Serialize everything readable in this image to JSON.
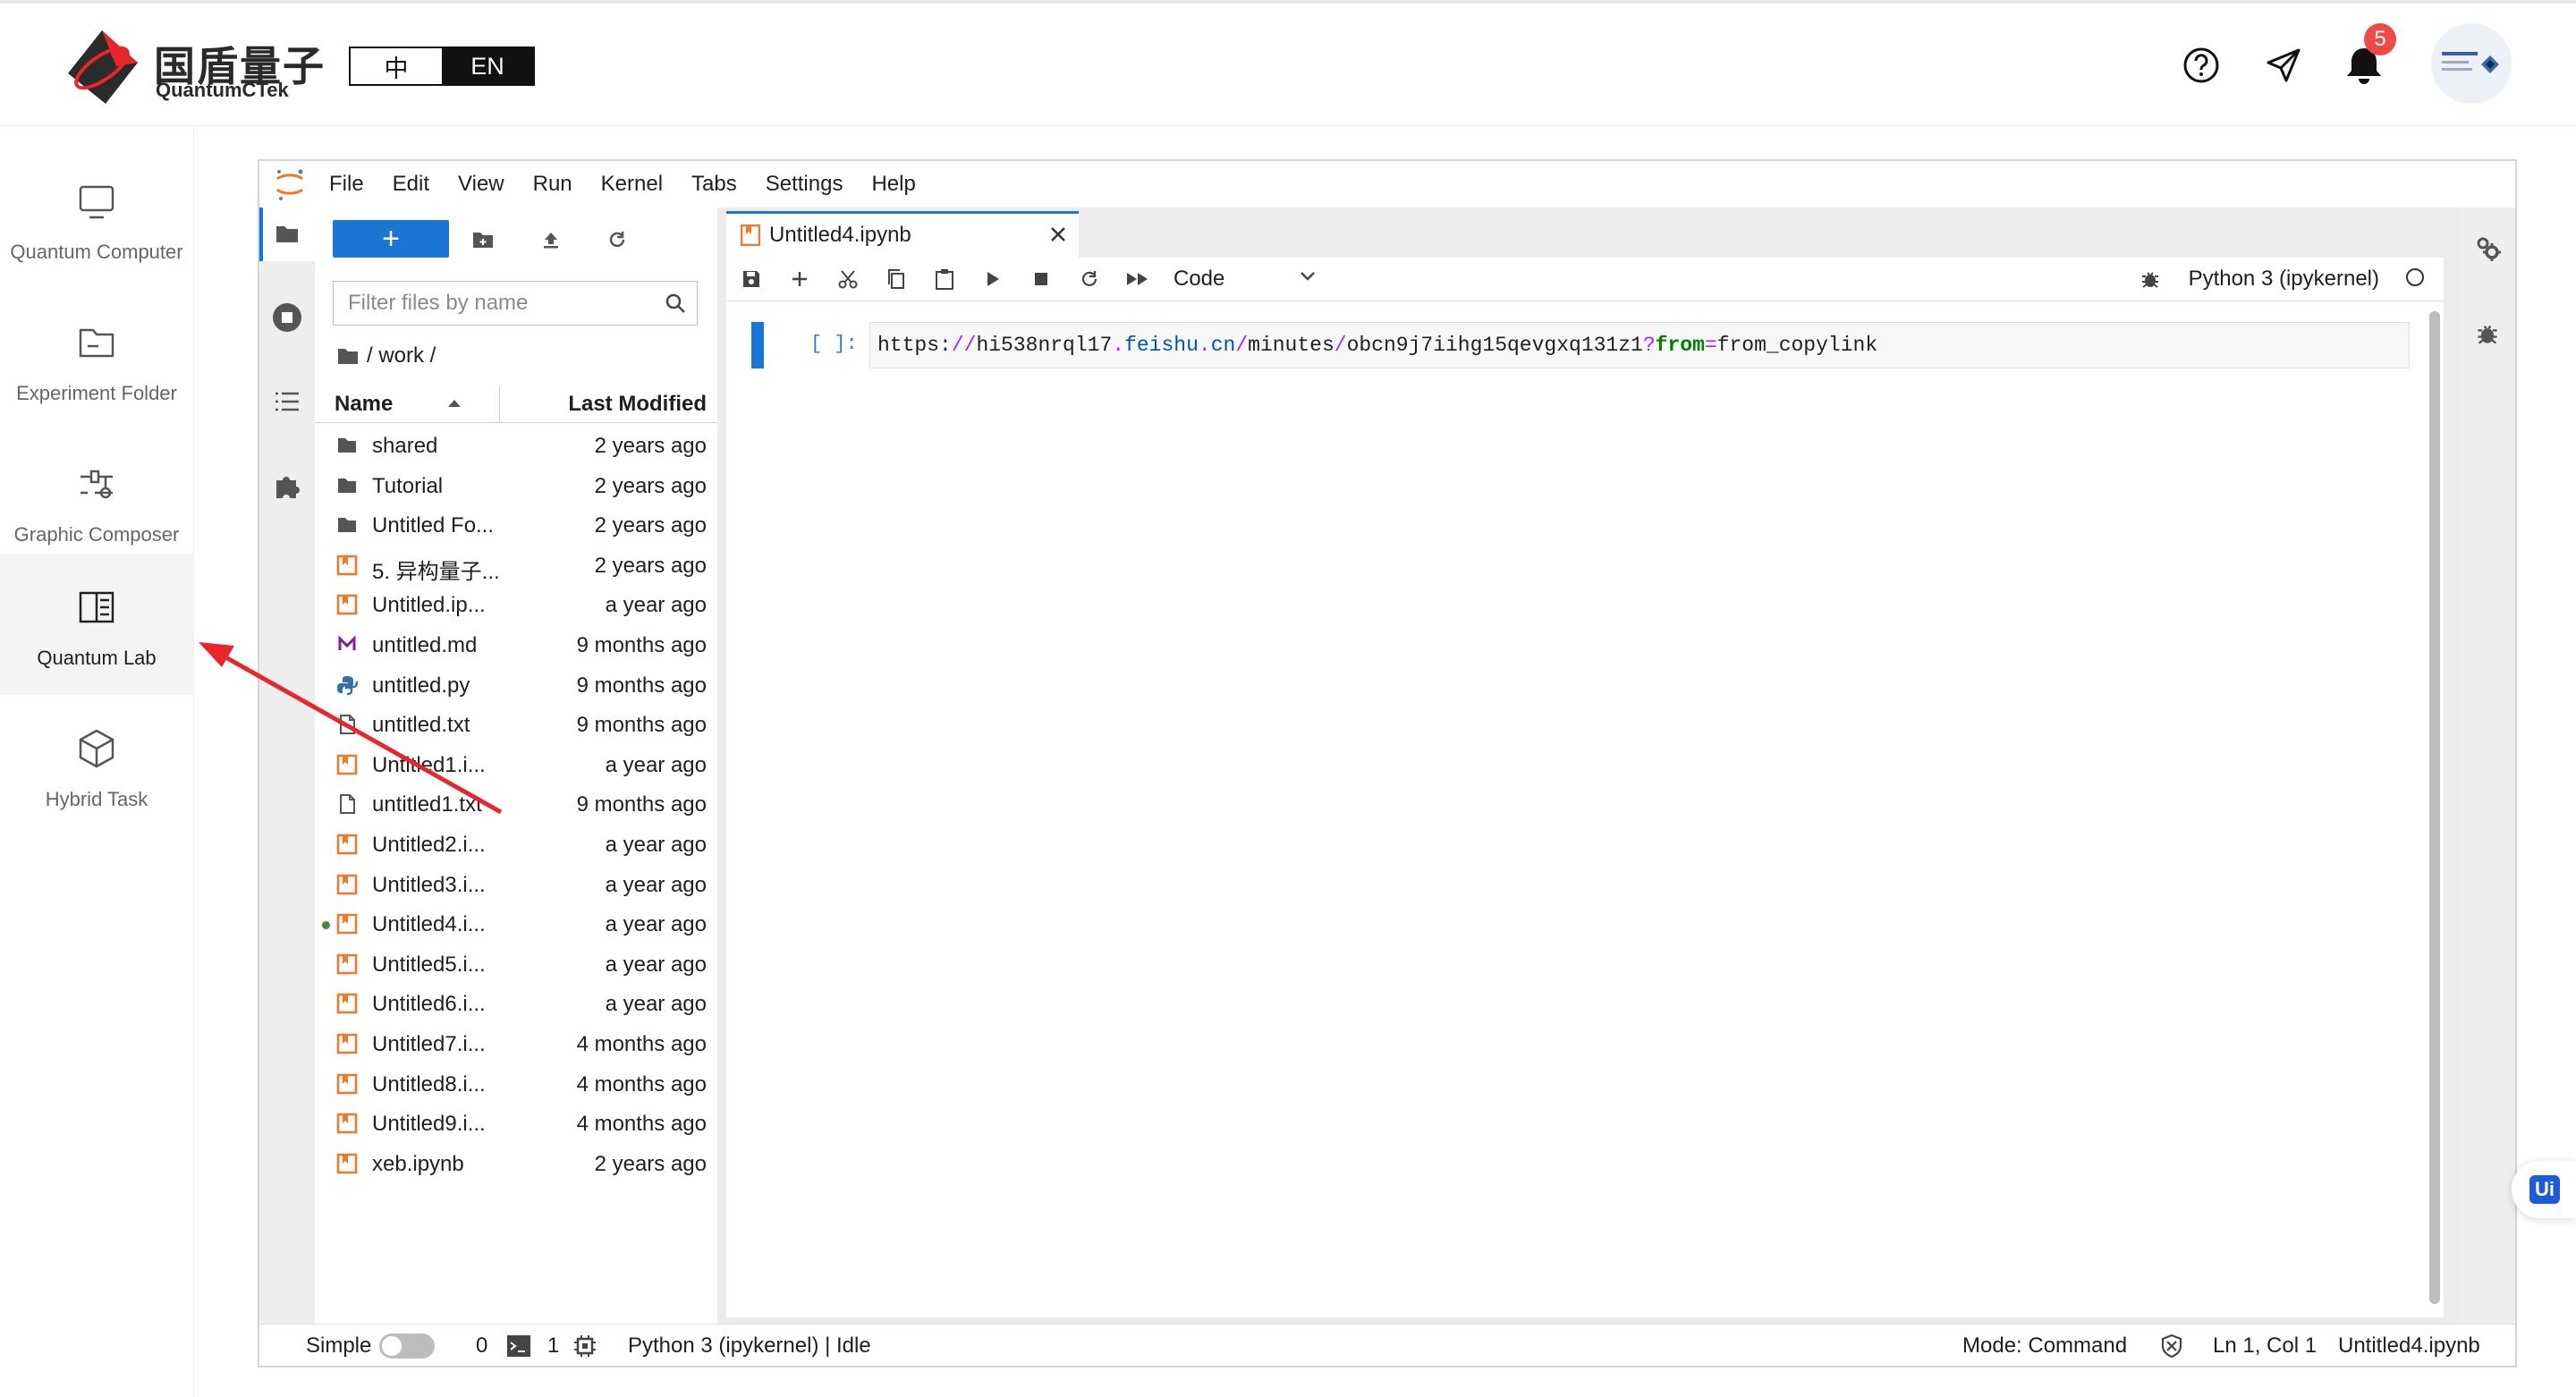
{
  "header": {
    "logo_cn": "国盾量子",
    "logo_en": "QuantumCTek",
    "lang_zh": "中",
    "lang_en": "EN",
    "notification_count": "5",
    "icons": [
      "help-icon",
      "send-icon",
      "bell-icon"
    ]
  },
  "leftnav": {
    "items": [
      {
        "label": "Quantum Computer",
        "icon": "monitor-icon"
      },
      {
        "label": "Experiment Folder",
        "icon": "folder-icon"
      },
      {
        "label": "Graphic Composer",
        "icon": "circuit-icon"
      },
      {
        "label": "Quantum Lab",
        "icon": "lab-panel-icon",
        "active": true
      },
      {
        "label": "Hybrid Task",
        "icon": "cube-icon"
      }
    ]
  },
  "jupyter": {
    "menu": [
      "File",
      "Edit",
      "View",
      "Run",
      "Kernel",
      "Tabs",
      "Settings",
      "Help"
    ],
    "filebrowser": {
      "new_label": "+",
      "filter_placeholder": "Filter files by name",
      "breadcrumb": "/ work /",
      "col_name": "Name",
      "col_modified": "Last Modified",
      "files": [
        {
          "name": "shared",
          "modified": "2 years ago",
          "type": "folder"
        },
        {
          "name": "Tutorial",
          "modified": "2 years ago",
          "type": "folder"
        },
        {
          "name": "Untitled Fo...",
          "modified": "2 years ago",
          "type": "folder"
        },
        {
          "name": "5. 异构量子...",
          "modified": "2 years ago",
          "type": "notebook"
        },
        {
          "name": "Untitled.ip...",
          "modified": "a year ago",
          "type": "notebook"
        },
        {
          "name": "untitled.md",
          "modified": "9 months ago",
          "type": "markdown"
        },
        {
          "name": "untitled.py",
          "modified": "9 months ago",
          "type": "python"
        },
        {
          "name": "untitled.txt",
          "modified": "9 months ago",
          "type": "text"
        },
        {
          "name": "Untitled1.i...",
          "modified": "a year ago",
          "type": "notebook"
        },
        {
          "name": "untitled1.txt",
          "modified": "9 months ago",
          "type": "text"
        },
        {
          "name": "Untitled2.i...",
          "modified": "a year ago",
          "type": "notebook"
        },
        {
          "name": "Untitled3.i...",
          "modified": "a year ago",
          "type": "notebook"
        },
        {
          "name": "Untitled4.i...",
          "modified": "a year ago",
          "type": "notebook",
          "running": true
        },
        {
          "name": "Untitled5.i...",
          "modified": "a year ago",
          "type": "notebook"
        },
        {
          "name": "Untitled6.i...",
          "modified": "a year ago",
          "type": "notebook"
        },
        {
          "name": "Untitled7.i...",
          "modified": "4 months ago",
          "type": "notebook"
        },
        {
          "name": "Untitled8.i...",
          "modified": "4 months ago",
          "type": "notebook"
        },
        {
          "name": "Untitled9.i...",
          "modified": "4 months ago",
          "type": "notebook"
        },
        {
          "name": "xeb.ipynb",
          "modified": "2 years ago",
          "type": "notebook"
        }
      ]
    },
    "notebook": {
      "tab_title": "Untitled4.ipynb",
      "cell_type": "Code",
      "kernel": "Python 3 (ipykernel)",
      "cell_prompt": "[ ]:",
      "cell_tokens": [
        {
          "t": "https:",
          "c": ""
        },
        {
          "t": "//",
          "c": "m"
        },
        {
          "t": "hi538nrql17",
          "c": ""
        },
        {
          "t": ".",
          "c": "m"
        },
        {
          "t": "feishu",
          "c": "b"
        },
        {
          "t": ".",
          "c": "m"
        },
        {
          "t": "cn",
          "c": "b"
        },
        {
          "t": "/",
          "c": "m"
        },
        {
          "t": "minutes",
          "c": ""
        },
        {
          "t": "/",
          "c": "m"
        },
        {
          "t": "obcn9j7iihg15qevgxq131z1",
          "c": ""
        },
        {
          "t": "?",
          "c": "m"
        },
        {
          "t": "from",
          "c": "k"
        },
        {
          "t": "=",
          "c": "m"
        },
        {
          "t": "from_copylink",
          "c": ""
        }
      ]
    },
    "statusbar": {
      "simple_label": "Simple",
      "terminals_count": "0",
      "kernels_count": "1",
      "kernel_status": "Python 3 (ipykernel) | Idle",
      "mode": "Mode: Command",
      "position": "Ln 1, Col 1",
      "filename": "Untitled4.ipynb"
    }
  },
  "floating_button": "Ui",
  "colors": {
    "accent": "#1976d2",
    "notebook_icon": "#f37726",
    "badge": "#f0494a",
    "annotation_arrow": "#e8262b"
  }
}
